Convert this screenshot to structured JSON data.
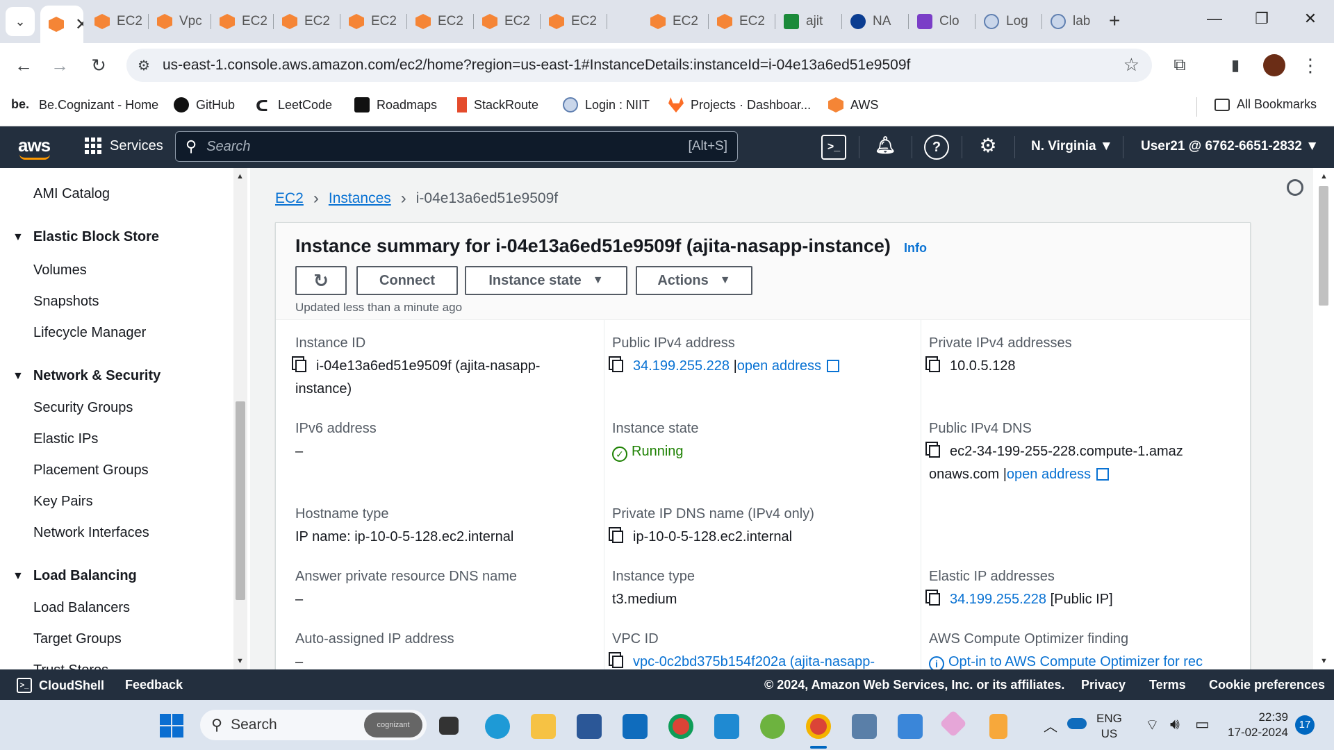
{
  "browser": {
    "tabs": [
      {
        "label": "",
        "icon": "aws-icon",
        "active": true
      },
      {
        "label": "EC2",
        "icon": "aws-icon"
      },
      {
        "label": "Vpc",
        "icon": "aws-icon"
      },
      {
        "label": "EC2",
        "icon": "aws-icon"
      },
      {
        "label": "EC2",
        "icon": "aws-icon"
      },
      {
        "label": "EC2",
        "icon": "aws-icon"
      },
      {
        "label": "EC2",
        "icon": "aws-icon"
      },
      {
        "label": "EC2",
        "icon": "aws-icon"
      },
      {
        "label": "EC2",
        "icon": "aws-icon"
      },
      {
        "label": "EC2",
        "icon": "aws-icon"
      },
      {
        "label": "EC2",
        "icon": "aws-icon"
      },
      {
        "label": "ajit",
        "icon": "green-app-icon"
      },
      {
        "label": "NA",
        "icon": "nasa-icon"
      },
      {
        "label": "Clo",
        "icon": "purple-app-icon"
      },
      {
        "label": "Log",
        "icon": "globe-icon"
      },
      {
        "label": "lab",
        "icon": "globe-icon"
      }
    ],
    "url": "us-east-1.console.aws.amazon.com/ec2/home?region=us-east-1#InstanceDetails:instanceId=i-04e13a6ed51e9509f",
    "bookmarks": [
      {
        "label": "Be.Cognizant - Home",
        "icon": "be-icon"
      },
      {
        "label": "GitHub",
        "icon": "github-icon"
      },
      {
        "label": "LeetCode",
        "icon": "leetcode-icon"
      },
      {
        "label": "Roadmaps",
        "icon": "roadmaps-icon"
      },
      {
        "label": "StackRoute",
        "icon": "stackroute-icon"
      },
      {
        "label": "Login : NIIT",
        "icon": "globe-icon"
      },
      {
        "label": "Projects · Dashboar...",
        "icon": "gitlab-icon"
      },
      {
        "label": "AWS",
        "icon": "aws-icon"
      }
    ],
    "all_bookmarks": "All Bookmarks"
  },
  "aws_header": {
    "logo": "aws",
    "services": "Services",
    "search_placeholder": "Search",
    "search_shortcut": "[Alt+S]",
    "region": "N. Virginia",
    "account": "User21 @ 6762-6651-2832"
  },
  "sidebar": {
    "top_item": "AMI Catalog",
    "sections": [
      {
        "title": "Elastic Block Store",
        "items": [
          "Volumes",
          "Snapshots",
          "Lifecycle Manager"
        ]
      },
      {
        "title": "Network & Security",
        "items": [
          "Security Groups",
          "Elastic IPs",
          "Placement Groups",
          "Key Pairs",
          "Network Interfaces"
        ]
      },
      {
        "title": "Load Balancing",
        "items": [
          "Load Balancers",
          "Target Groups",
          "Trust Stores"
        ]
      }
    ]
  },
  "breadcrumb": {
    "ec2": "EC2",
    "instances": "Instances",
    "current": "i-04e13a6ed51e9509f"
  },
  "summary": {
    "title": "Instance summary for i-04e13a6ed51e9509f (ajita-nasapp-instance)",
    "info": "Info",
    "buttons": {
      "connect": "Connect",
      "instance_state": "Instance state",
      "actions": "Actions"
    },
    "updated": "Updated less than a minute ago",
    "fields": {
      "instance_id_label": "Instance ID",
      "instance_id_value": "i-04e13a6ed51e9509f (ajita-nasapp-instance)",
      "public_ipv4_label": "Public IPv4 address",
      "public_ipv4_value": "34.199.255.228",
      "open_address": "open address",
      "private_ipv4_label": "Private IPv4 addresses",
      "private_ipv4_value": "10.0.5.128",
      "ipv6_label": "IPv6 address",
      "ipv6_value": "–",
      "instance_state_label": "Instance state",
      "instance_state_value": "Running",
      "public_dns_label": "Public IPv4 DNS",
      "public_dns_value": "ec2-34-199-255-228.compute-1.amazonaws.com",
      "hostname_type_label": "Hostname type",
      "hostname_type_value": "IP name: ip-10-0-5-128.ec2.internal",
      "private_dns_label": "Private IP DNS name (IPv4 only)",
      "private_dns_value": "ip-10-0-5-128.ec2.internal",
      "answer_dns_label": "Answer private resource DNS name",
      "answer_dns_value": "–",
      "instance_type_label": "Instance type",
      "instance_type_value": "t3.medium",
      "elastic_ip_label": "Elastic IP addresses",
      "elastic_ip_value": "34.199.255.228",
      "elastic_ip_suffix": "[Public IP]",
      "auto_ip_label": "Auto-assigned IP address",
      "auto_ip_value": "–",
      "vpc_label": "VPC ID",
      "vpc_value": "vpc-0c2bd375b154f202a (ajita-nasapp-",
      "optimizer_label": "AWS Compute Optimizer finding",
      "optimizer_value": "Opt-in to AWS Compute Optimizer for rec"
    }
  },
  "footer": {
    "cloudshell": "CloudShell",
    "feedback": "Feedback",
    "copyright": "© 2024, Amazon Web Services, Inc. or its affiliates.",
    "privacy": "Privacy",
    "terms": "Terms",
    "cookies": "Cookie preferences"
  },
  "taskbar": {
    "search": "Search",
    "search_badge": "cognizant",
    "lang_top": "ENG",
    "lang_bottom": "US",
    "time": "22:39",
    "date": "17-02-2024",
    "notifications": "17"
  }
}
